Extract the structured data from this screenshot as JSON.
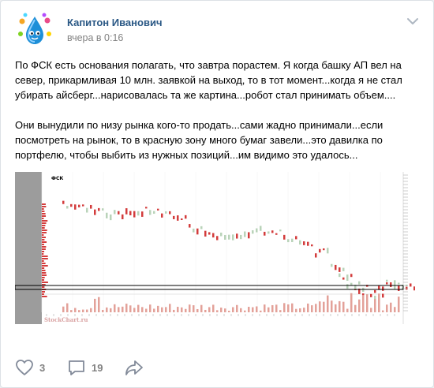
{
  "post": {
    "author": "Капитон Иванович",
    "time": "вчера в 0:16",
    "paragraphs": [
      "По ФСК есть основания полагать, что завтра порастем. Я когда башку АП вел на север, прикармливая 10 млн. заявкой на выход, то в тот момент...когда я не стал убирать айсберг...нарисовалась та же картина...робот стал принимать объем....",
      "Они вынудили по низу рынка кого-то продать...сами жадно принимали...если посмотреть на рынок, то в красную зону много бумаг завели...это давилка по портфелю, чтобы выбить из нужных позиций...им видимо это удалось..."
    ]
  },
  "attachment": {
    "chart_title": "ФСК",
    "watermark": "StockChart.ru",
    "colors": {
      "up": "#b9d3b9",
      "down": "#d33c3c",
      "volume": "#e3a199",
      "profile": "#9c9c9c"
    }
  },
  "actions": {
    "likes": "3",
    "comments": "19",
    "icons": [
      "heart-icon",
      "comment-icon",
      "share-icon"
    ]
  }
}
